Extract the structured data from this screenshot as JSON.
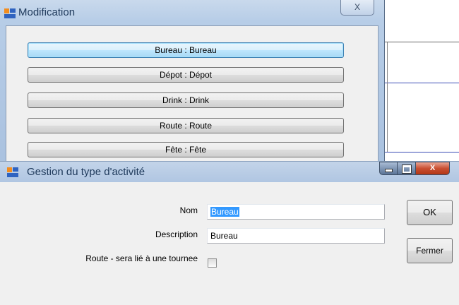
{
  "modification_window": {
    "title": "Modification",
    "close_label": "X",
    "items": [
      {
        "label": "Bureau : Bureau"
      },
      {
        "label": "Dépot : Dépot"
      },
      {
        "label": "Drink : Drink"
      },
      {
        "label": "Route : Route"
      },
      {
        "label": "Fête : Fête"
      }
    ]
  },
  "gestion_window": {
    "title": "Gestion du type d'activité",
    "close_label": "X",
    "fields": {
      "nom_label": "Nom",
      "nom_value": "Bureau",
      "description_label": "Description",
      "description_value": "Bureau",
      "route_label": "Route - sera lié à une tournee",
      "route_checked": false
    },
    "buttons": {
      "ok": "OK",
      "fermer": "Fermer"
    }
  }
}
